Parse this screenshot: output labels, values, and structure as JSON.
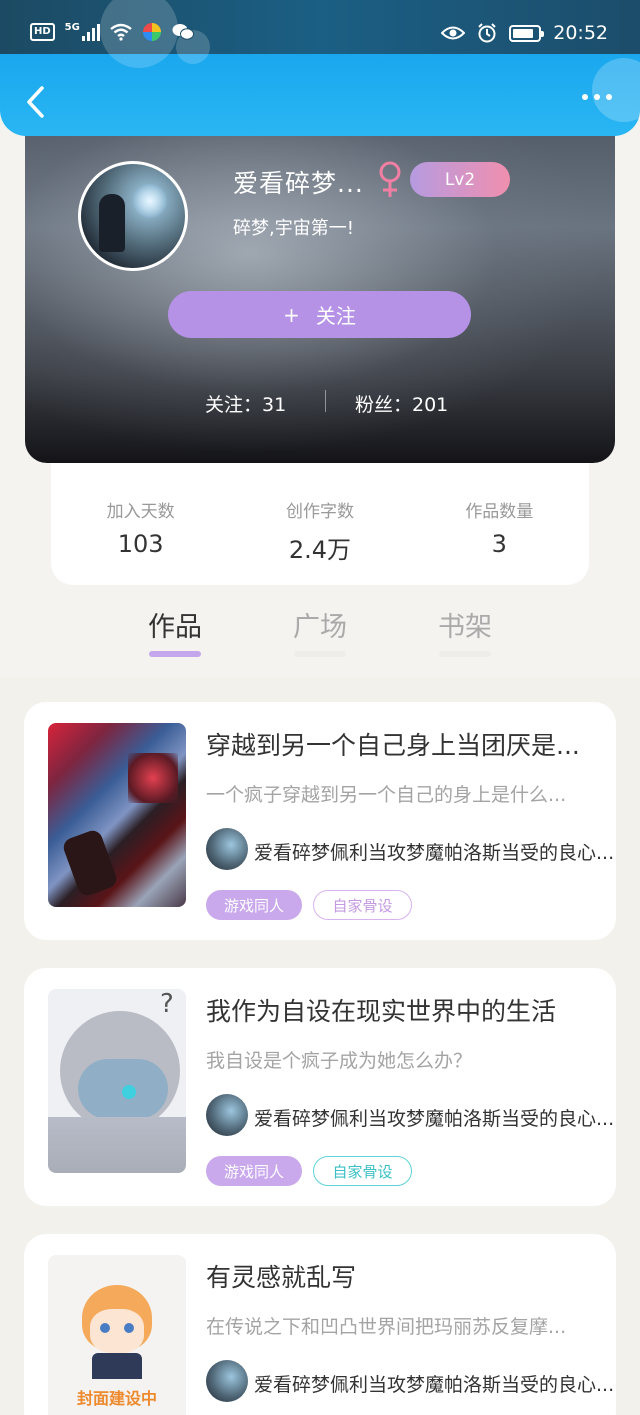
{
  "status_bar": {
    "hd": "HD",
    "network": "5G",
    "time": "20:52"
  },
  "profile": {
    "nickname": "爱看碎梦...",
    "level": "Lv2",
    "motto": "碎梦,宇宙第一!",
    "follow_button": "关注",
    "follow_plus": "+",
    "following": "关注：31",
    "fans": "粉丝：201"
  },
  "stats": [
    {
      "label": "加入天数",
      "value": "103"
    },
    {
      "label": "创作字数",
      "value": "2.4万"
    },
    {
      "label": "作品数量",
      "value": "3"
    }
  ],
  "tabs": [
    {
      "label": "作品",
      "active": true
    },
    {
      "label": "广场",
      "active": false
    },
    {
      "label": "书架",
      "active": false
    }
  ],
  "works": [
    {
      "title": "穿越到另一个自己身上当团厌是...",
      "description": "一个疯子穿越到另一个自己的身上是什么...",
      "author": "爱看碎梦佩利当攻梦魔帕洛斯当受的良心...",
      "tags": [
        "游戏同人",
        "自家骨设"
      ],
      "tag2_color": "purple"
    },
    {
      "title": "我作为自设在现实世界中的生活",
      "description": "我自设是个疯子成为她怎么办？",
      "author": "爱看碎梦佩利当攻梦魔帕洛斯当受的良心...",
      "tags": [
        "游戏同人",
        "自家骨设"
      ],
      "tag2_color": "teal"
    },
    {
      "title": "有灵感就乱写",
      "description": "在传说之下和凹凸世界间把玛丽苏反复摩...",
      "author": "爱看碎梦佩利当攻梦魔帕洛斯当受的良心...",
      "cover_text": "封面建设中"
    }
  ],
  "colors": {
    "accent": "#b592e6",
    "header": "#1aa7ee",
    "teal_tag": "#3cc0c5"
  },
  "icons": [
    "back-arrow-icon",
    "more-icon",
    "female-icon",
    "eye-icon",
    "alarm-icon",
    "battery-icon",
    "wifi-icon",
    "signal-icon"
  ]
}
